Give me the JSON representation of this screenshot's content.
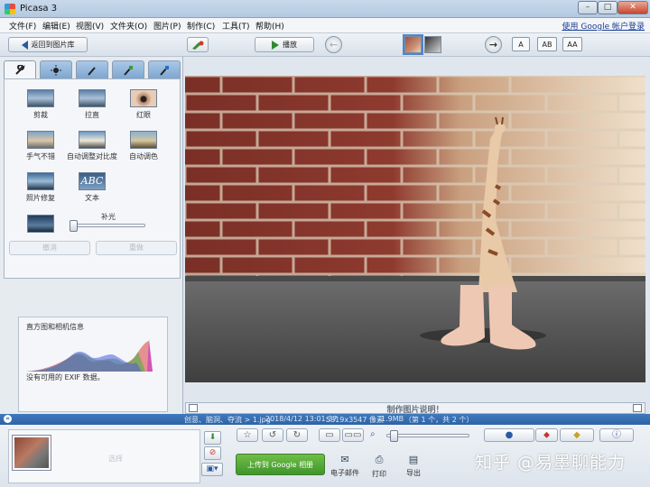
{
  "window": {
    "title": "Picasa 3",
    "minimize": "–",
    "maximize": "□",
    "close": "✕"
  },
  "menu": {
    "items": [
      "文件(F)",
      "编辑(E)",
      "视图(V)",
      "文件夹(O)",
      "图片(P)",
      "制作(C)",
      "工具(T)",
      "帮助(H)"
    ],
    "signin": "使用 Google 帐户登录"
  },
  "toolbar": {
    "back_label": "返回到图片库",
    "play_label": "播放",
    "text_sizes": [
      "A",
      "AB",
      "AA"
    ]
  },
  "edit_tabs": [
    "wrench-icon",
    "sun-icon",
    "brush-icon",
    "brush-green-icon",
    "brush-blue-icon"
  ],
  "tools": [
    {
      "label": "剪裁",
      "icon": "crop-icon"
    },
    {
      "label": "拉直",
      "icon": "straighten-icon"
    },
    {
      "label": "红眼",
      "icon": "redeye-icon"
    },
    {
      "label": "手气不错",
      "icon": "lucky-icon"
    },
    {
      "label": "自动调整对比度",
      "icon": "auto-contrast-icon"
    },
    {
      "label": "自动调色",
      "icon": "auto-color-icon"
    },
    {
      "label": "照片修复",
      "icon": "retouch-icon"
    },
    {
      "label": "文本",
      "icon": "text-icon",
      "icon_text": "ABC"
    }
  ],
  "fill_light": {
    "label": "补光",
    "value": 0
  },
  "undo_label": "撤消",
  "redo_label": "重做",
  "histogram": {
    "title": "直方图和相机信息",
    "note": "没有可用的 EXIF 数据。"
  },
  "caption": {
    "placeholder": "制作图片说明！"
  },
  "status": {
    "path": "创意、脑洞、夺流 > 1.jpg",
    "datetime": "2018/4/12 13:01:37",
    "dimensions": "5319x3547 像素",
    "size": "1.9MB",
    "position": "（第 1 个，共 2 个）"
  },
  "tray": {
    "placeholder": "选择"
  },
  "bottom": {
    "upload_label": "上传到 Google 相册",
    "email_label": "电子邮件",
    "print_label": "打印",
    "export_label": "导出",
    "watermark": "知乎 @易墨聊能力"
  }
}
